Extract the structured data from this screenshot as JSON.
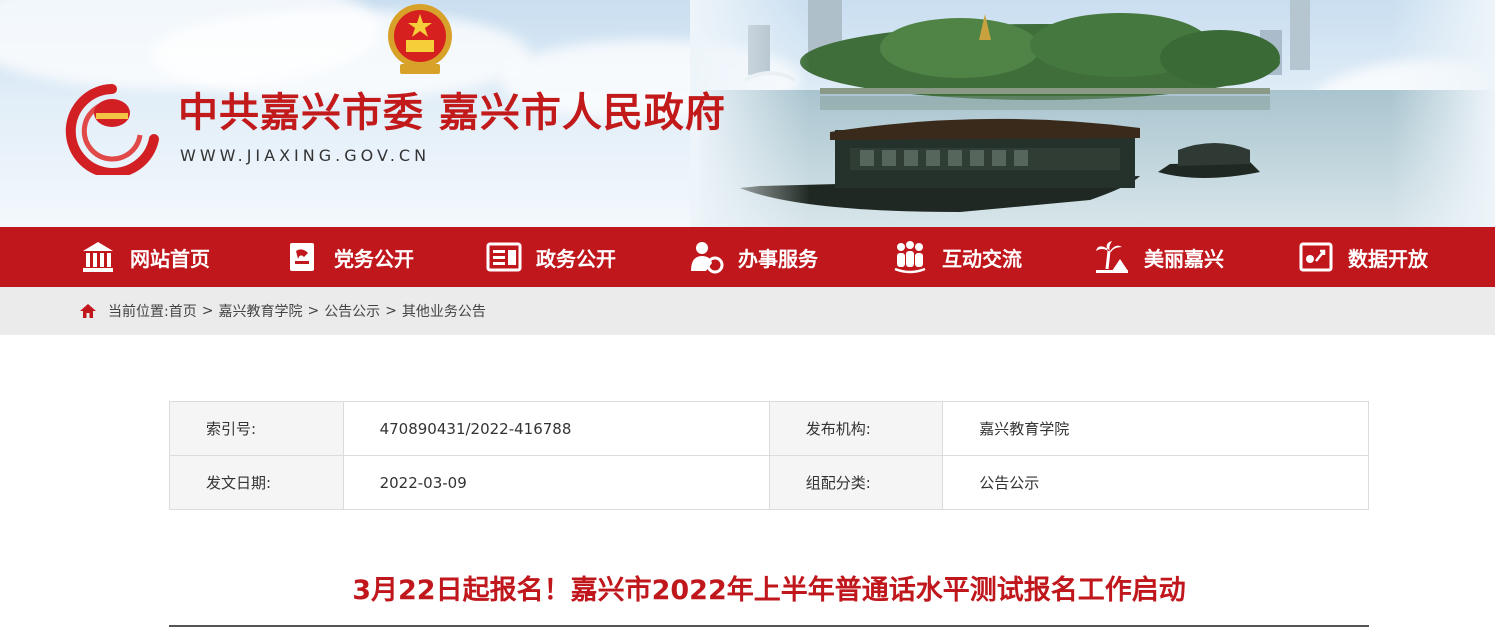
{
  "header": {
    "site_title": "中共嘉兴市委 嘉兴市人民政府",
    "site_url": "WWW.JIAXING.GOV.CN"
  },
  "nav": {
    "items": [
      {
        "label": "网站首页",
        "icon": "building-icon"
      },
      {
        "label": "党务公开",
        "icon": "party-flag-icon"
      },
      {
        "label": "政务公开",
        "icon": "document-icon"
      },
      {
        "label": "办事服务",
        "icon": "service-icon"
      },
      {
        "label": "互动交流",
        "icon": "people-icon"
      },
      {
        "label": "美丽嘉兴",
        "icon": "palm-tree-icon"
      },
      {
        "label": "数据开放",
        "icon": "data-icon"
      }
    ]
  },
  "breadcrumb": {
    "prefix": "当前位置:",
    "items": [
      "首页",
      "嘉兴教育学院",
      "公告公示",
      "其他业务公告"
    ],
    "separator": ">"
  },
  "meta": {
    "index_label": "索引号:",
    "index_value": "470890431/2022-416788",
    "publisher_label": "发布机构:",
    "publisher_value": "嘉兴教育学院",
    "date_label": "发文日期:",
    "date_value": "2022-03-09",
    "category_label": "组配分类:",
    "category_value": "公告公示"
  },
  "article": {
    "title": "3月22日起报名！嘉兴市2022年上半年普通话水平测试报名工作启动"
  },
  "colors": {
    "brand_red": "#c0171d",
    "crumb_bg": "#ebebeb"
  }
}
